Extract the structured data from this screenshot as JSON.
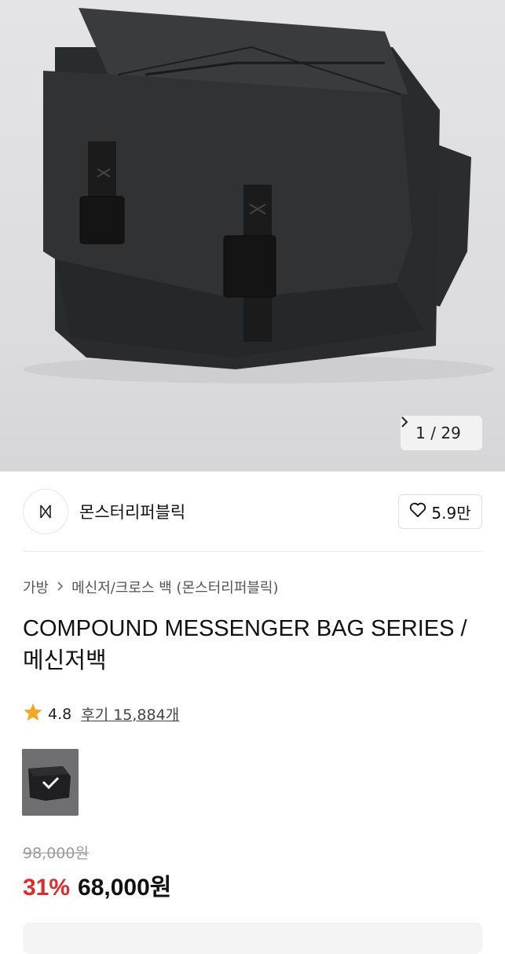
{
  "gallery": {
    "counter_text": "1 / 29",
    "next_icon": "chevron-right-icon"
  },
  "brand": {
    "name": "몬스터리퍼블릭",
    "logo_icon": "brand-logo-icon",
    "likes_label": "5.9만",
    "like_icon": "heart-outline-icon"
  },
  "breadcrumb": {
    "items": [
      "가방",
      "메신저/크로스 백 (몬스터리퍼블릭)"
    ],
    "separator_icon": "chevron-right-icon"
  },
  "product": {
    "title_line1": "COMPOUND MESSENGER BAG SERIES /",
    "title_line2": "메신저백",
    "rating": "4.8",
    "reviews_label": "후기 15,884개",
    "original_price": "98,000원",
    "discount": "31%",
    "price": "68,000원"
  },
  "colors": {
    "discount": "#e02b2b",
    "star": "#f5a623"
  }
}
